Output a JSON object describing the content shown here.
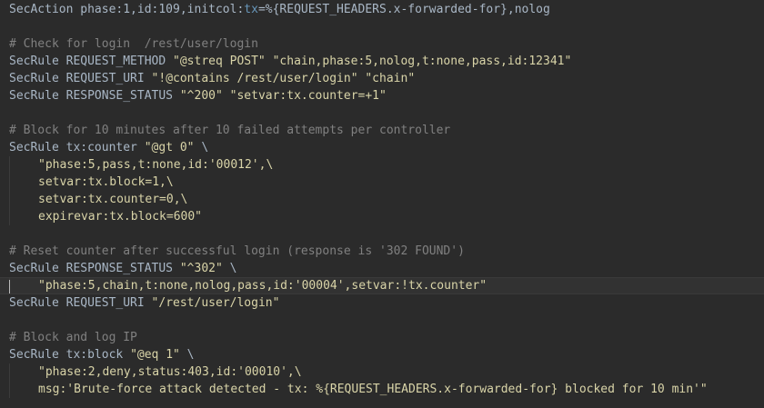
{
  "editor": {
    "theme_colors": {
      "background": "#2b2b2b",
      "text": "#a9b7c6",
      "comment": "#808080",
      "string": "#d9d4a8",
      "highlight": "#6897bb"
    },
    "lines": [
      {
        "indent": false,
        "segments": [
          {
            "t": "text",
            "v": "SecAction phase:1,id:109,initcol:"
          },
          {
            "t": "var",
            "v": "tx"
          },
          {
            "t": "text",
            "v": "=%{REQUEST_HEADERS.x-forwarded-for},nolog"
          }
        ]
      },
      {
        "indent": false,
        "segments": []
      },
      {
        "indent": false,
        "segments": [
          {
            "t": "comment",
            "v": "# Check for login  /rest/user/login"
          }
        ]
      },
      {
        "indent": false,
        "segments": [
          {
            "t": "text",
            "v": "SecRule REQUEST_METHOD "
          },
          {
            "t": "string",
            "v": "\"@streq POST\""
          },
          {
            "t": "text",
            "v": " "
          },
          {
            "t": "string",
            "v": "\"chain,phase:5,nolog,t:none,pass,id:12341\""
          }
        ]
      },
      {
        "indent": false,
        "segments": [
          {
            "t": "text",
            "v": "SecRule REQUEST_URI "
          },
          {
            "t": "string",
            "v": "\"!@contains /rest/user/login\""
          },
          {
            "t": "text",
            "v": " "
          },
          {
            "t": "string",
            "v": "\"chain\""
          }
        ]
      },
      {
        "indent": false,
        "segments": [
          {
            "t": "text",
            "v": "SecRule RESPONSE_STATUS "
          },
          {
            "t": "string",
            "v": "\"^200\""
          },
          {
            "t": "text",
            "v": " "
          },
          {
            "t": "string",
            "v": "\"setvar:tx.counter=+1\""
          }
        ]
      },
      {
        "indent": false,
        "segments": []
      },
      {
        "indent": false,
        "segments": [
          {
            "t": "comment",
            "v": "# Block for 10 minutes after 10 failed attempts per controller"
          }
        ]
      },
      {
        "indent": false,
        "segments": [
          {
            "t": "text",
            "v": "SecRule tx:counter "
          },
          {
            "t": "string",
            "v": "\"@gt 0\""
          },
          {
            "t": "text",
            "v": " \\"
          }
        ]
      },
      {
        "indent": true,
        "segments": [
          {
            "t": "string",
            "v": "\"phase:5,pass,t:none,id:'00012',\\"
          }
        ]
      },
      {
        "indent": true,
        "segments": [
          {
            "t": "string",
            "v": "setvar:tx.block=1,\\"
          }
        ]
      },
      {
        "indent": true,
        "segments": [
          {
            "t": "string",
            "v": "setvar:tx.counter=0,\\"
          }
        ]
      },
      {
        "indent": true,
        "segments": [
          {
            "t": "string",
            "v": "expirevar:tx.block=600\""
          }
        ]
      },
      {
        "indent": false,
        "segments": []
      },
      {
        "indent": false,
        "segments": [
          {
            "t": "comment",
            "v": "# Reset counter after successful login (response is '302 FOUND')"
          }
        ]
      },
      {
        "indent": false,
        "segments": [
          {
            "t": "text",
            "v": "SecRule RESPONSE_STATUS "
          },
          {
            "t": "string",
            "v": "\"^302\""
          },
          {
            "t": "text",
            "v": " \\"
          }
        ]
      },
      {
        "indent": true,
        "caret": true,
        "segments": [
          {
            "t": "string",
            "v": "\"phase:5,chain,t:none,nolog,pass,id:'00004',setvar:!tx.counter\""
          }
        ]
      },
      {
        "indent": false,
        "segments": [
          {
            "t": "text",
            "v": "SecRule REQUEST_URI "
          },
          {
            "t": "string",
            "v": "\"/rest/user/login\""
          }
        ]
      },
      {
        "indent": false,
        "segments": []
      },
      {
        "indent": false,
        "segments": [
          {
            "t": "comment",
            "v": "# Block and log IP"
          }
        ]
      },
      {
        "indent": false,
        "segments": [
          {
            "t": "text",
            "v": "SecRule tx:block "
          },
          {
            "t": "string",
            "v": "\"@eq 1\""
          },
          {
            "t": "text",
            "v": " \\"
          }
        ]
      },
      {
        "indent": true,
        "segments": [
          {
            "t": "string",
            "v": "\"phase:2,deny,status:403,id:'00010',\\"
          }
        ]
      },
      {
        "indent": true,
        "segments": [
          {
            "t": "string",
            "v": "msg:'Brute-force attack detected - tx: %{REQUEST_HEADERS.x-forwarded-for} blocked for 10 min'\""
          }
        ]
      }
    ]
  }
}
